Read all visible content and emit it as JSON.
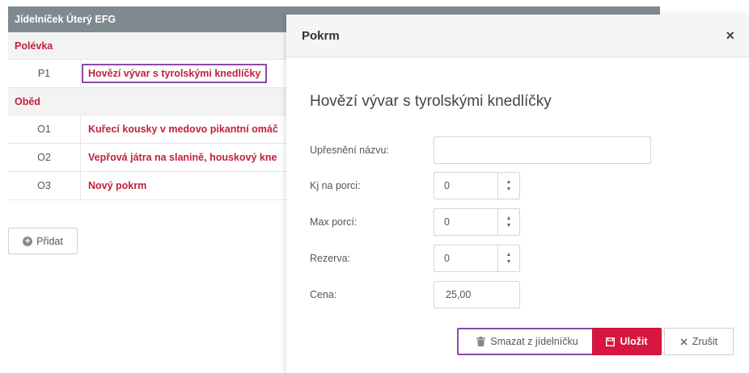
{
  "menu": {
    "title": "Jídelníček Úterý EFG",
    "sections": [
      {
        "name": "Polévka",
        "items": [
          {
            "code": "P1",
            "name": "Hovězí vývar s tyrolskými knedlíčky"
          }
        ]
      },
      {
        "name": "Oběd",
        "items": [
          {
            "code": "O1",
            "name": "Kuřecí kousky v medovo pikantní omáč"
          },
          {
            "code": "O2",
            "name": "Vepřová játra na slanině, houskový kne"
          },
          {
            "code": "O3",
            "name": "Nový pokrm"
          }
        ]
      }
    ],
    "add_label": "Přidat"
  },
  "modal": {
    "title": "Pokrm",
    "close_glyph": "×",
    "dish_name": "Hovězí vývar s tyrolskými knedlíčky",
    "fields": {
      "name_detail": {
        "label": "Upřesnění názvu:",
        "value": ""
      },
      "kj_per_portion": {
        "label": "Kj na porci:",
        "value": "0"
      },
      "max_portions": {
        "label": "Max porcí:",
        "value": "0"
      },
      "reserve": {
        "label": "Rezerva:",
        "value": "0"
      },
      "price": {
        "label": "Cena:",
        "value": "25,00"
      }
    },
    "buttons": {
      "delete": "Smazat z jídelníčku",
      "save": "Uložit",
      "cancel": "Zrušit"
    }
  },
  "colors": {
    "accent_red": "#c0203d",
    "save_red": "#d9163f",
    "highlight_purple": "#8c4aa6",
    "header_gray": "#7f8a90"
  },
  "icons": {
    "add": "plus-circle-icon",
    "close": "close-icon",
    "delete": "trash-icon",
    "save": "floppy-disk-icon",
    "cancel": "x-icon",
    "stepper": "chevron-up-down-icon"
  }
}
